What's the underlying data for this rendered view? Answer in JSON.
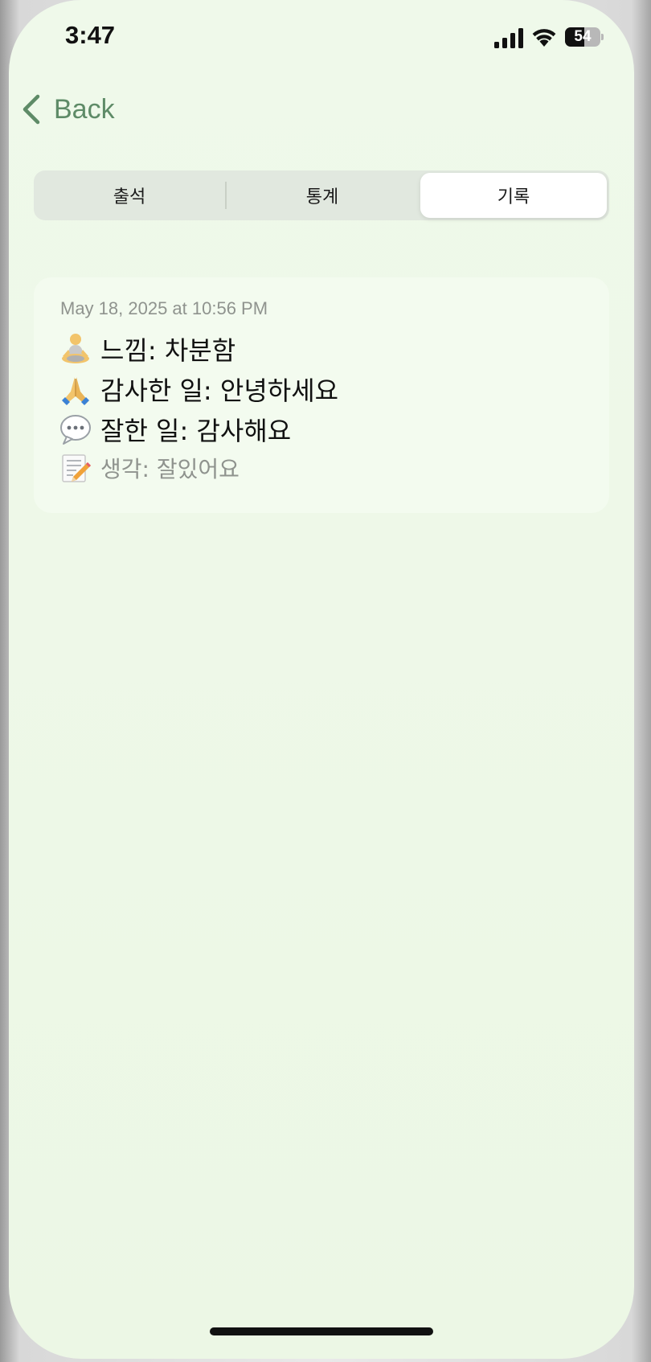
{
  "status_bar": {
    "time": "3:47",
    "battery_percent": "54",
    "battery_level": 0.54
  },
  "nav": {
    "back_label": "Back"
  },
  "tabs": [
    {
      "label": "출석",
      "selected": false
    },
    {
      "label": "통계",
      "selected": false
    },
    {
      "label": "기록",
      "selected": true
    }
  ],
  "entries": [
    {
      "date": "May 18, 2025 at 10:56 PM",
      "feeling": {
        "icon": "meditation-icon",
        "text": "느낌: 차분함"
      },
      "gratitude": {
        "icon": "folded-hands-icon",
        "text": "감사한 일: 안녕하세요"
      },
      "well_done": {
        "icon": "speech-bubble-icon",
        "text": "잘한 일: 감사해요"
      },
      "thought": {
        "icon": "memo-icon",
        "text": "생각: 잘있어요"
      }
    }
  ],
  "colors": {
    "background": "#ecf7e5",
    "accent": "#5e8b67",
    "card": "#f3fbef",
    "secondary_text": "#8f938e"
  }
}
